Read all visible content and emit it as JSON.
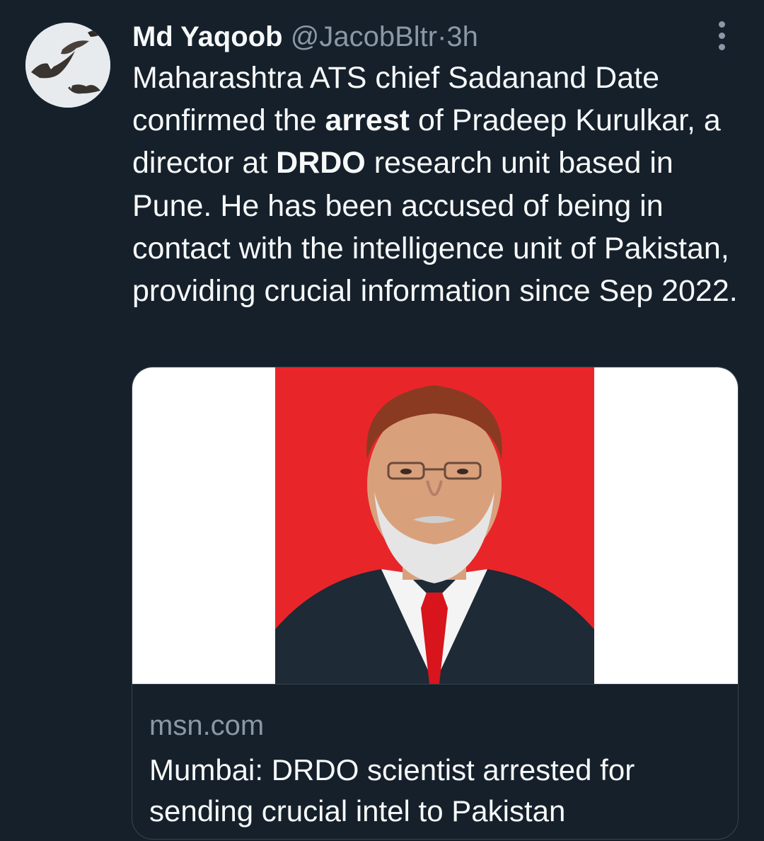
{
  "author": {
    "name": "Md Yaqoob",
    "handle": "@JacobBltr",
    "separator": "·",
    "time": "3h",
    "avatar_icon": "birds-avatar"
  },
  "tweet": {
    "p1": "Maharashtra ATS chief Sadanand Date confirmed the ",
    "b1": "arrest",
    "p2": " of Pradeep Kurulkar, a director at ",
    "b2": "DRDO",
    "p3": " research unit based in Pune. He has been accused of being in contact with the intelligence unit of Pakistan, providing crucial information since Sep 2022."
  },
  "card": {
    "domain": "msn.com",
    "headline": "Mumbai: DRDO scientist arrested for sending crucial intel to Pakistan",
    "photo_background": "#e8262a",
    "media_background": "#ffffff"
  },
  "colors": {
    "background": "#15202b",
    "text": "#f7f9f9",
    "secondary": "#8b98a5",
    "border": "#38444d"
  }
}
